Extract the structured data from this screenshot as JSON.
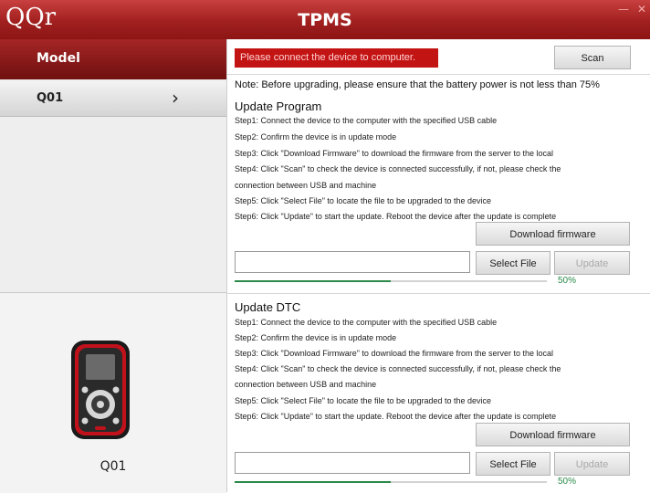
{
  "app": {
    "logo": "QQr",
    "title": "TPMS"
  },
  "sidebar": {
    "header": "Model",
    "items": [
      {
        "label": "Q01"
      }
    ],
    "device_label": "Q01"
  },
  "main": {
    "status": "Please connect the device to computer.",
    "scan_label": "Scan",
    "note": "Note: Before upgrading, please ensure that the battery power is not less than 75%",
    "sections": [
      {
        "title": "Update Program",
        "steps": [
          "Step1: Connect the device to the computer with the specified USB cable",
          "Step2: Confirm the device is in update mode",
          "Step3: Click \"Download Firmware\" to download the firmware from the server to the local",
          "Step4: Click \"Scan\" to check the device is connected successfully, if not, please check the",
          "connection between USB and machine",
          "Step5: Click \"Select File\" to locate the file to be upgraded to the device",
          "Step6: Click \"Update\" to start the update. Reboot the device after the update is complete"
        ],
        "download_label": "Download firmware",
        "select_label": "Select File",
        "update_label": "Update",
        "file_value": "",
        "progress": 50,
        "progress_text": "50%"
      },
      {
        "title": "Update DTC",
        "steps": [
          "Step1: Connect the device to the computer with the specified USB cable",
          "Step2: Confirm the device is in update mode",
          "Step3: Click \"Download Firmware\" to download the firmware from the server to the local",
          "Step4: Click \"Scan\" to check the device is connected successfully, if not, please check the",
          "connection between USB and machine",
          "Step5: Click \"Select File\" to locate the file to be upgraded to the device",
          "Step6: Click \"Update\" to start the update. Reboot the device after the update is complete"
        ],
        "download_label": "Download firmware",
        "select_label": "Select File",
        "update_label": "Update",
        "file_value": "",
        "progress": 50,
        "progress_text": "50%"
      }
    ]
  }
}
